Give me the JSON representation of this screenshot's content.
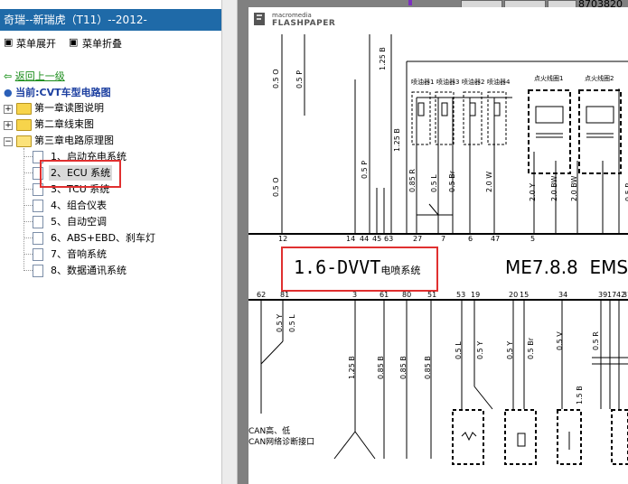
{
  "window": {
    "title": "奇瑞--新瑞虎（T11）--2012-"
  },
  "toolbar": {
    "expand_label": "菜单展开",
    "collapse_label": "菜单折叠"
  },
  "nav": {
    "back_label": "返回上一级",
    "current_label": "当前:CVT车型电路图"
  },
  "tree": {
    "chapters": [
      {
        "label": "第一章读图说明"
      },
      {
        "label": "第二章线束图"
      },
      {
        "label": "第三章电路原理图"
      }
    ],
    "items": [
      {
        "label": "1、启动充电系统"
      },
      {
        "label": "2、ECU 系统"
      },
      {
        "label": "3、TCU 系统"
      },
      {
        "label": "4、组合仪表"
      },
      {
        "label": "5、自动空调"
      },
      {
        "label": "6、ABS+EBD、刹车灯"
      },
      {
        "label": "7、音响系统"
      },
      {
        "label": "8、数据通讯系统"
      }
    ]
  },
  "viewer": {
    "top_number": "8703820",
    "logo_top": "macromedia",
    "logo_bottom": "FLASHPAPER",
    "ems_label": "ME7.8.8  EMS",
    "highlight_prefix": "1.6-DVVT",
    "highlight_suffix": "电喷系统",
    "pin_numbers": [
      "12",
      "14",
      "44",
      "45",
      "63",
      "27",
      "7",
      "6",
      "47",
      "5"
    ],
    "lower_pins": [
      "62",
      "81",
      "3",
      "61",
      "80",
      "51",
      "53",
      "19",
      "20",
      "15",
      "34",
      "39",
      "17",
      "42",
      "37"
    ],
    "can_labels": [
      "CAN高、低",
      "CAN网络诊断接口"
    ],
    "injector_labels": [
      "喷油器1",
      "喷油器3",
      "喷油器2",
      "喷油器4"
    ],
    "ignition_labels": [
      "点火线圈1",
      "点火线圈2"
    ],
    "wire_labels": [
      "0.5 R",
      "0.5 P",
      "0.5 O",
      "0.5 L",
      "0.85 B",
      "0.5 Y",
      "0.85 R",
      "1.25 B",
      "0.5 Br",
      "0.5 V",
      "2.0 W",
      "2.0 Y",
      "2.0 BW",
      "20 R",
      "1.25 B",
      "1.5 B"
    ]
  }
}
